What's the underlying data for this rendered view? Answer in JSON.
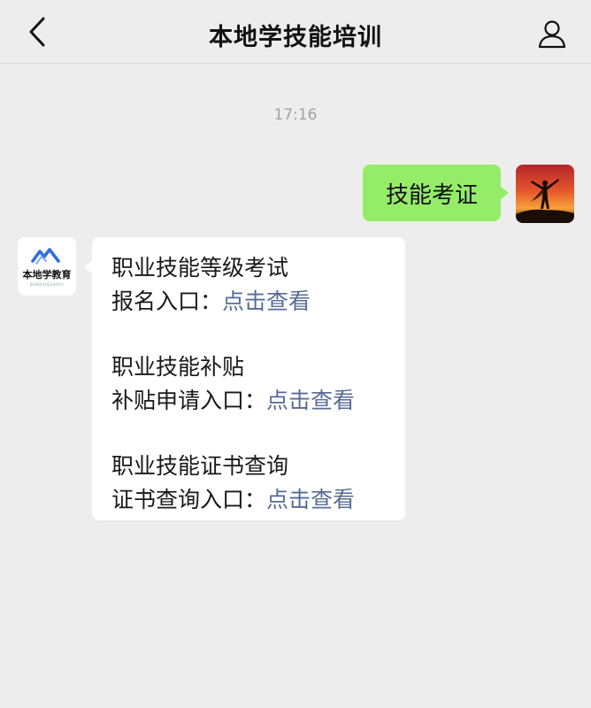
{
  "header": {
    "title": "本地学技能培训",
    "back_icon": "chevron-left-icon",
    "profile_icon": "person-icon"
  },
  "chat": {
    "timestamp": "17:16",
    "sent_message": "技能考证",
    "received": {
      "logo": {
        "text": "本地学教育",
        "subtext": "BENDIXUEJIAOYU",
        "color": "#2f6fe0"
      },
      "blocks": [
        {
          "title": "职业技能等级考试",
          "prefix": "报名入口：",
          "link": "点击查看"
        },
        {
          "title": "职业技能补贴",
          "prefix": "补贴申请入口：",
          "link": "点击查看"
        },
        {
          "title": "职业技能证书查询",
          "prefix": "证书查询入口：",
          "link": "点击查看"
        }
      ]
    }
  },
  "colors": {
    "background": "#ededed",
    "sent_bubble": "#95ec69",
    "received_bubble": "#ffffff",
    "link": "#576b95",
    "timestamp": "#a3a3a3"
  }
}
